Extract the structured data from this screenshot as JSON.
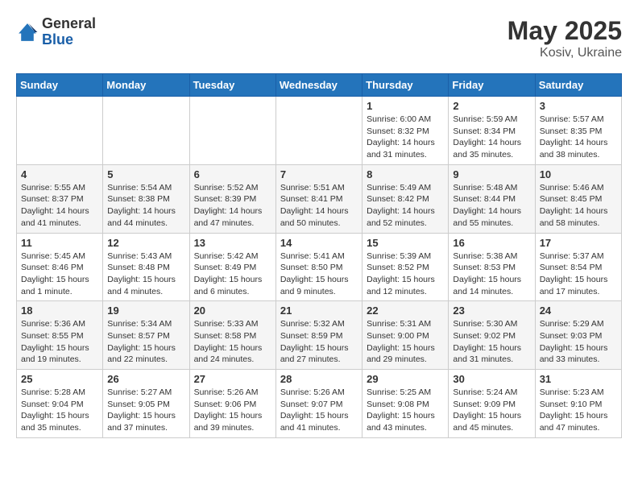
{
  "logo": {
    "general": "General",
    "blue": "Blue"
  },
  "title": {
    "month_year": "May 2025",
    "location": "Kosiv, Ukraine"
  },
  "headers": [
    "Sunday",
    "Monday",
    "Tuesday",
    "Wednesday",
    "Thursday",
    "Friday",
    "Saturday"
  ],
  "weeks": [
    [
      {
        "day": "",
        "info": ""
      },
      {
        "day": "",
        "info": ""
      },
      {
        "day": "",
        "info": ""
      },
      {
        "day": "",
        "info": ""
      },
      {
        "day": "1",
        "info": "Sunrise: 6:00 AM\nSunset: 8:32 PM\nDaylight: 14 hours\nand 31 minutes."
      },
      {
        "day": "2",
        "info": "Sunrise: 5:59 AM\nSunset: 8:34 PM\nDaylight: 14 hours\nand 35 minutes."
      },
      {
        "day": "3",
        "info": "Sunrise: 5:57 AM\nSunset: 8:35 PM\nDaylight: 14 hours\nand 38 minutes."
      }
    ],
    [
      {
        "day": "4",
        "info": "Sunrise: 5:55 AM\nSunset: 8:37 PM\nDaylight: 14 hours\nand 41 minutes."
      },
      {
        "day": "5",
        "info": "Sunrise: 5:54 AM\nSunset: 8:38 PM\nDaylight: 14 hours\nand 44 minutes."
      },
      {
        "day": "6",
        "info": "Sunrise: 5:52 AM\nSunset: 8:39 PM\nDaylight: 14 hours\nand 47 minutes."
      },
      {
        "day": "7",
        "info": "Sunrise: 5:51 AM\nSunset: 8:41 PM\nDaylight: 14 hours\nand 50 minutes."
      },
      {
        "day": "8",
        "info": "Sunrise: 5:49 AM\nSunset: 8:42 PM\nDaylight: 14 hours\nand 52 minutes."
      },
      {
        "day": "9",
        "info": "Sunrise: 5:48 AM\nSunset: 8:44 PM\nDaylight: 14 hours\nand 55 minutes."
      },
      {
        "day": "10",
        "info": "Sunrise: 5:46 AM\nSunset: 8:45 PM\nDaylight: 14 hours\nand 58 minutes."
      }
    ],
    [
      {
        "day": "11",
        "info": "Sunrise: 5:45 AM\nSunset: 8:46 PM\nDaylight: 15 hours\nand 1 minute."
      },
      {
        "day": "12",
        "info": "Sunrise: 5:43 AM\nSunset: 8:48 PM\nDaylight: 15 hours\nand 4 minutes."
      },
      {
        "day": "13",
        "info": "Sunrise: 5:42 AM\nSunset: 8:49 PM\nDaylight: 15 hours\nand 6 minutes."
      },
      {
        "day": "14",
        "info": "Sunrise: 5:41 AM\nSunset: 8:50 PM\nDaylight: 15 hours\nand 9 minutes."
      },
      {
        "day": "15",
        "info": "Sunrise: 5:39 AM\nSunset: 8:52 PM\nDaylight: 15 hours\nand 12 minutes."
      },
      {
        "day": "16",
        "info": "Sunrise: 5:38 AM\nSunset: 8:53 PM\nDaylight: 15 hours\nand 14 minutes."
      },
      {
        "day": "17",
        "info": "Sunrise: 5:37 AM\nSunset: 8:54 PM\nDaylight: 15 hours\nand 17 minutes."
      }
    ],
    [
      {
        "day": "18",
        "info": "Sunrise: 5:36 AM\nSunset: 8:55 PM\nDaylight: 15 hours\nand 19 minutes."
      },
      {
        "day": "19",
        "info": "Sunrise: 5:34 AM\nSunset: 8:57 PM\nDaylight: 15 hours\nand 22 minutes."
      },
      {
        "day": "20",
        "info": "Sunrise: 5:33 AM\nSunset: 8:58 PM\nDaylight: 15 hours\nand 24 minutes."
      },
      {
        "day": "21",
        "info": "Sunrise: 5:32 AM\nSunset: 8:59 PM\nDaylight: 15 hours\nand 27 minutes."
      },
      {
        "day": "22",
        "info": "Sunrise: 5:31 AM\nSunset: 9:00 PM\nDaylight: 15 hours\nand 29 minutes."
      },
      {
        "day": "23",
        "info": "Sunrise: 5:30 AM\nSunset: 9:02 PM\nDaylight: 15 hours\nand 31 minutes."
      },
      {
        "day": "24",
        "info": "Sunrise: 5:29 AM\nSunset: 9:03 PM\nDaylight: 15 hours\nand 33 minutes."
      }
    ],
    [
      {
        "day": "25",
        "info": "Sunrise: 5:28 AM\nSunset: 9:04 PM\nDaylight: 15 hours\nand 35 minutes."
      },
      {
        "day": "26",
        "info": "Sunrise: 5:27 AM\nSunset: 9:05 PM\nDaylight: 15 hours\nand 37 minutes."
      },
      {
        "day": "27",
        "info": "Sunrise: 5:26 AM\nSunset: 9:06 PM\nDaylight: 15 hours\nand 39 minutes."
      },
      {
        "day": "28",
        "info": "Sunrise: 5:26 AM\nSunset: 9:07 PM\nDaylight: 15 hours\nand 41 minutes."
      },
      {
        "day": "29",
        "info": "Sunrise: 5:25 AM\nSunset: 9:08 PM\nDaylight: 15 hours\nand 43 minutes."
      },
      {
        "day": "30",
        "info": "Sunrise: 5:24 AM\nSunset: 9:09 PM\nDaylight: 15 hours\nand 45 minutes."
      },
      {
        "day": "31",
        "info": "Sunrise: 5:23 AM\nSunset: 9:10 PM\nDaylight: 15 hours\nand 47 minutes."
      }
    ]
  ]
}
